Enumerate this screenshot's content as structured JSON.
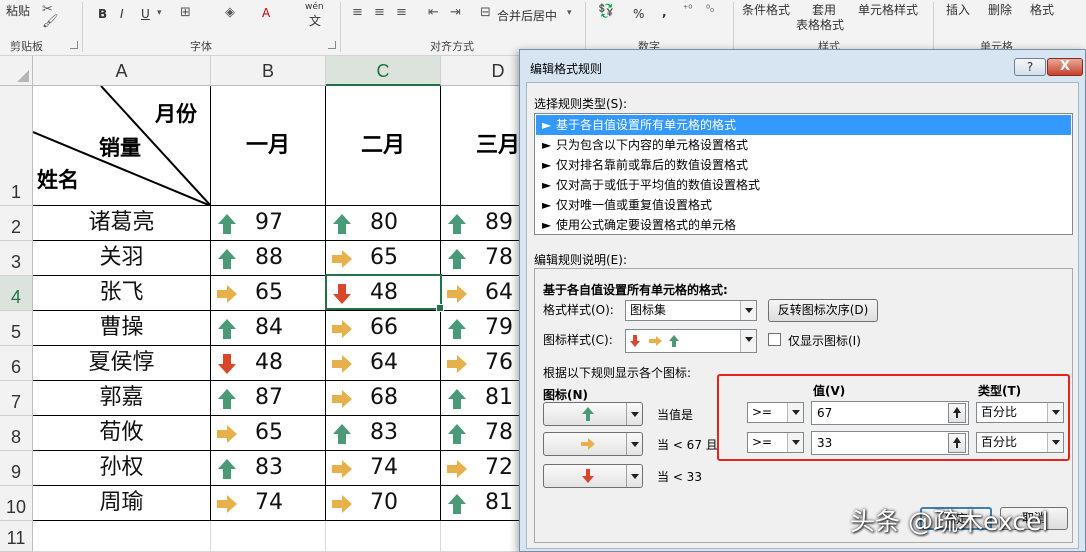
{
  "ribbon": {
    "paste": "粘贴",
    "clipboard_group": "剪贴板",
    "font_group": "字体",
    "alignment_group": "对齐方式",
    "number_group": "数字",
    "styles_group": "样式",
    "cells_group": "单元格",
    "bold": "B",
    "italic": "I",
    "underline": "U",
    "font_color_glyph": "A",
    "wen": "wén",
    "wen_char": "文",
    "merge_center": "合并后居中",
    "percent": "%",
    "comma": ",",
    "cond_format": "条件格式",
    "apply_table_format_1": "套用",
    "apply_table_format_2": "表格格式",
    "cell_styles": "单元格样式",
    "insert": "插入",
    "delete": "删除",
    "format": "格式"
  },
  "sheet": {
    "columns": [
      "A",
      "B",
      "C",
      "D"
    ],
    "rows": [
      "1",
      "2",
      "3",
      "4",
      "5",
      "6",
      "7",
      "8",
      "9",
      "10",
      "11"
    ],
    "header_month": "月份",
    "header_sales": "销量",
    "header_name": "姓名",
    "months": [
      "一月",
      "二月",
      "三月"
    ],
    "records": [
      {
        "name": "诸葛亮",
        "values": [
          97,
          80,
          89
        ]
      },
      {
        "name": "关羽",
        "values": [
          88,
          65,
          78
        ]
      },
      {
        "name": "张飞",
        "values": [
          65,
          48,
          64
        ]
      },
      {
        "name": "曹操",
        "values": [
          84,
          66,
          79
        ]
      },
      {
        "name": "夏侯惇",
        "values": [
          48,
          64,
          76
        ]
      },
      {
        "name": "郭嘉",
        "values": [
          87,
          68,
          81
        ]
      },
      {
        "name": "荀攸",
        "values": [
          65,
          83,
          78
        ]
      },
      {
        "name": "孙权",
        "values": [
          83,
          74,
          72
        ]
      },
      {
        "name": "周瑜",
        "values": [
          74,
          70,
          81
        ]
      }
    ],
    "icon_colors": {
      "up": "#4a9a78",
      "right": "#e6b04a",
      "down": "#d9472b"
    }
  },
  "dialog": {
    "title": "编辑格式规则",
    "help": "?",
    "close": "X",
    "select_type_label": "选择规则类型(S):",
    "rule_types": [
      "基于各自值设置所有单元格的格式",
      "只为包含以下内容的单元格设置格式",
      "仅对排名靠前或靠后的数值设置格式",
      "仅对高于或低于平均值的数值设置格式",
      "仅对唯一值或重复值设置格式",
      "使用公式确定要设置格式的单元格"
    ],
    "edit_desc_label": "编辑规则说明(E):",
    "format_all_label": "基于各自值设置所有单元格的格式:",
    "format_style_label": "格式样式(O):",
    "format_style_value": "图标集",
    "reverse_button": "反转图标次序(D)",
    "icon_style_label": "图标样式(C):",
    "show_icon_only": "仅显示图标(I)",
    "rules_intro": "根据以下规则显示各个图标:",
    "icon_col": "图标(N)",
    "value_col": "值(V)",
    "type_col": "类型(T)",
    "rule_rows": [
      {
        "desc": "当值是",
        "op": ">=",
        "value": "67",
        "type": "百分比"
      },
      {
        "desc": "当 < 67 且",
        "op": ">=",
        "value": "33",
        "type": "百分比"
      },
      {
        "desc": "当 < 33"
      }
    ],
    "ok_button": "确定",
    "cancel_button": "取消"
  },
  "watermark": "头条 @疏木excel"
}
